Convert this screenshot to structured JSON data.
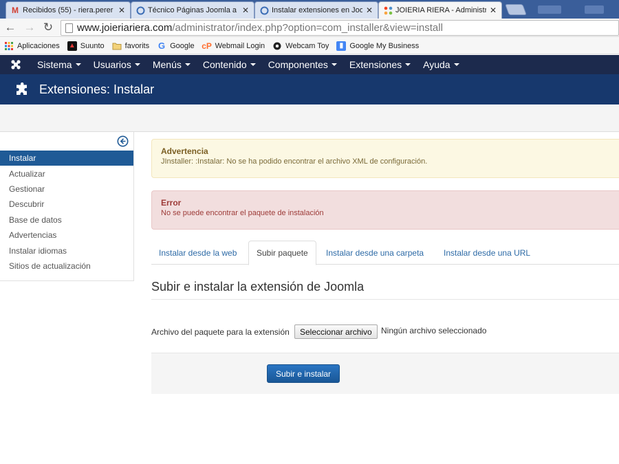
{
  "browser": {
    "tabs": [
      {
        "title": "Recibidos (55) - riera.perer",
        "icon": "gmail-icon"
      },
      {
        "title": "Técnico Páginas Joomla a",
        "icon": "loading-icon"
      },
      {
        "title": "Instalar extensiones en Joo",
        "icon": "loading-icon"
      },
      {
        "title": "JOIERIA RIERA - Administr",
        "icon": "joomla-icon",
        "active": true
      }
    ],
    "url_host": "www.joieriariera.com",
    "url_path": "/administrator/index.php?option=com_installer&view=install",
    "bookmarks": [
      {
        "label": "Aplicaciones",
        "icon": "apps-grid-icon"
      },
      {
        "label": "Suunto",
        "icon": "suunto-icon"
      },
      {
        "label": "favorits",
        "icon": "folder-icon"
      },
      {
        "label": "Google",
        "icon": "google-icon"
      },
      {
        "label": "Webmail Login",
        "icon": "cpanel-icon"
      },
      {
        "label": "Webcam Toy",
        "icon": "webcam-icon"
      },
      {
        "label": "Google My Business",
        "icon": "my-business-icon"
      }
    ]
  },
  "joomla": {
    "menu": [
      "Sistema",
      "Usuarios",
      "Menús",
      "Contenido",
      "Componentes",
      "Extensiones",
      "Ayuda"
    ],
    "page_title": "Extensiones: Instalar",
    "sidebar": [
      {
        "label": "Instalar",
        "active": true
      },
      {
        "label": "Actualizar"
      },
      {
        "label": "Gestionar"
      },
      {
        "label": "Descubrir"
      },
      {
        "label": "Base de datos"
      },
      {
        "label": "Advertencias"
      },
      {
        "label": "Instalar idiomas"
      },
      {
        "label": "Sitios de actualización"
      }
    ],
    "warning": {
      "title": "Advertencia",
      "message": "JInstaller: :Instalar: No se ha podido encontrar el archivo XML de configuración."
    },
    "error": {
      "title": "Error",
      "message": "No se puede encontrar el paquete de instalación"
    },
    "tabs": [
      "Instalar desde la web",
      "Subir paquete",
      "Instalar desde una carpeta",
      "Instalar desde una URL"
    ],
    "active_tab": "Subir paquete",
    "section_title": "Subir e instalar la extensión de Joomla",
    "file_label": "Archivo del paquete para la extensión",
    "file_button": "Seleccionar archivo",
    "file_status": "Ningún archivo seleccionado",
    "submit_label": "Subir e instalar"
  },
  "colors": {
    "joomla_nav": "#1c2a4d",
    "joomla_title": "#17386d",
    "accent": "#1f5a96"
  }
}
